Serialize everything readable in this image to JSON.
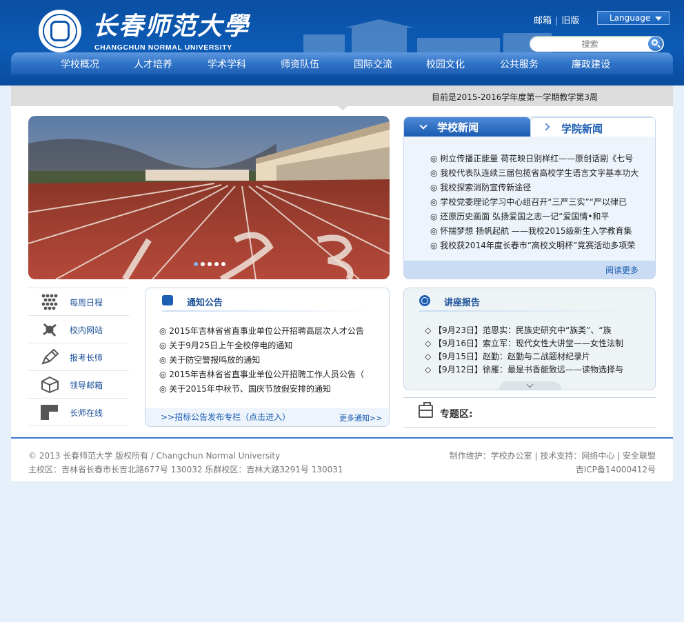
{
  "header": {
    "logo_cn": "长春师范大學",
    "logo_en": "CHANGCHUN NORMAL UNIVERSITY",
    "top_links": [
      "邮箱",
      "旧版"
    ],
    "language_label": "Language",
    "search_placeholder": "搜索"
  },
  "nav": {
    "items": [
      "学校概况",
      "人才培养",
      "学术学科",
      "师资队伍",
      "国际交流",
      "校园文化",
      "公共服务",
      "廉政建设"
    ]
  },
  "term_info": "目前是2015-2016学年度第一学期教学第3周",
  "slider": {
    "dot_count": 5,
    "active_dot": 1
  },
  "news": {
    "tabs": [
      "学校新闻",
      "学院新闻"
    ],
    "items": [
      "树立传播正能量 荷花映日别样红——原创话剧《七号",
      "我校代表队连续三届包揽省高校学生语言文字基本功大",
      "我校探索消防宣传新途径",
      "学校党委理论学习中心组召开“三严三实”“严以律已",
      "还原历史画面 弘扬爱国之志一记“爱国情•和平",
      "怀揣梦想 扬帆起航 ——我校2015级新生入学教育集",
      "我校获2014年度长春市“高校文明杯”竞赛活动多项荣"
    ],
    "more_label": "阅读更多"
  },
  "quick_links": [
    {
      "label": "每周日程",
      "icon": "grid-dots-icon"
    },
    {
      "label": "校内网站",
      "icon": "network-icon"
    },
    {
      "label": "报考长师",
      "icon": "pen-icon"
    },
    {
      "label": "领导邮箱",
      "icon": "cube-icon"
    },
    {
      "label": "长师在线",
      "icon": "square-icon"
    }
  ],
  "notice": {
    "title": "通知公告",
    "items": [
      "2015年吉林省省直事业单位公开招聘高层次人才公告",
      "关于9月25日上午全校停电的通知",
      "关于防空警报鸣放的通知",
      "2015年吉林省省直事业单位公开招聘工作人员公告（",
      "关于2015年中秋节、国庆节放假安排的通知"
    ],
    "foot_left": ">>招标公告发布专栏（点击进入）",
    "foot_right": "更多通知>>"
  },
  "lecture": {
    "title": "讲座报告",
    "items": [
      "【9月23日】范恩实：民族史研究中“族类”、“族",
      "【9月16日】索立军：现代女性大讲堂——女性法制",
      "【9月15日】赵勤：赵勤与二战题材纪录片",
      "【9月12日】徐雁：最是书香能致远——读物选择与"
    ]
  },
  "special": {
    "title": "专题区:"
  },
  "footer": {
    "line1_left": "© 2013 长春师范大学  版权所有  / Changchun Normal University",
    "line2_left": "主校区：吉林省长春市长吉北路677号  130032 乐群校区：吉林大路3291号  130031",
    "line1_right": "制作维护：学校办公室 | 技术支持：网络中心  | 安全联盟",
    "line2_right": "吉ICP备14000412号"
  },
  "colors": {
    "header_blue": "#0c5bb5",
    "link_blue": "#1a5bb2",
    "page_bg": "#e6f0fa"
  }
}
